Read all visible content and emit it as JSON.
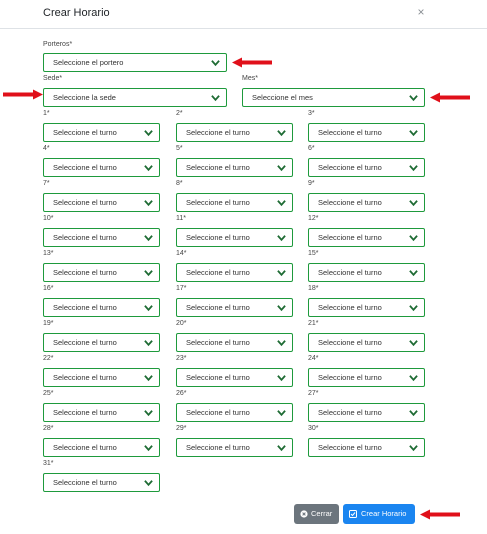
{
  "modal": {
    "title": "Crear Horario",
    "close_symbol": "×"
  },
  "porteros": {
    "label": "Porteros*",
    "placeholder": "Seleccione el portero"
  },
  "sede": {
    "label": "Sede*",
    "placeholder": "Seleccione la sede"
  },
  "mes": {
    "label": "Mes*",
    "placeholder": "Seleccione el mes"
  },
  "turno_placeholder": "Seleccione el turno",
  "days": [
    "1*",
    "2*",
    "3*",
    "4*",
    "5*",
    "6*",
    "7*",
    "8*",
    "9*",
    "10*",
    "11*",
    "12*",
    "13*",
    "14*",
    "15*",
    "16*",
    "17*",
    "18*",
    "19*",
    "20*",
    "21*",
    "22*",
    "23*",
    "24*",
    "25*",
    "26*",
    "27*",
    "28*",
    "29*",
    "30*",
    "31*"
  ],
  "buttons": {
    "cerrar": "Cerrar",
    "crear": "Crear Horario"
  },
  "icons": {
    "chevron": "chevron-down-icon",
    "annotation": "red-arrow-icon",
    "cerrar_icon": "x-circle-icon",
    "crear_icon": "checkbox-icon"
  },
  "colors": {
    "select_border": "#1e9a3c",
    "arrow": "#e0101a",
    "btn_close": "#6c757d",
    "btn_create": "#1a85f0"
  }
}
